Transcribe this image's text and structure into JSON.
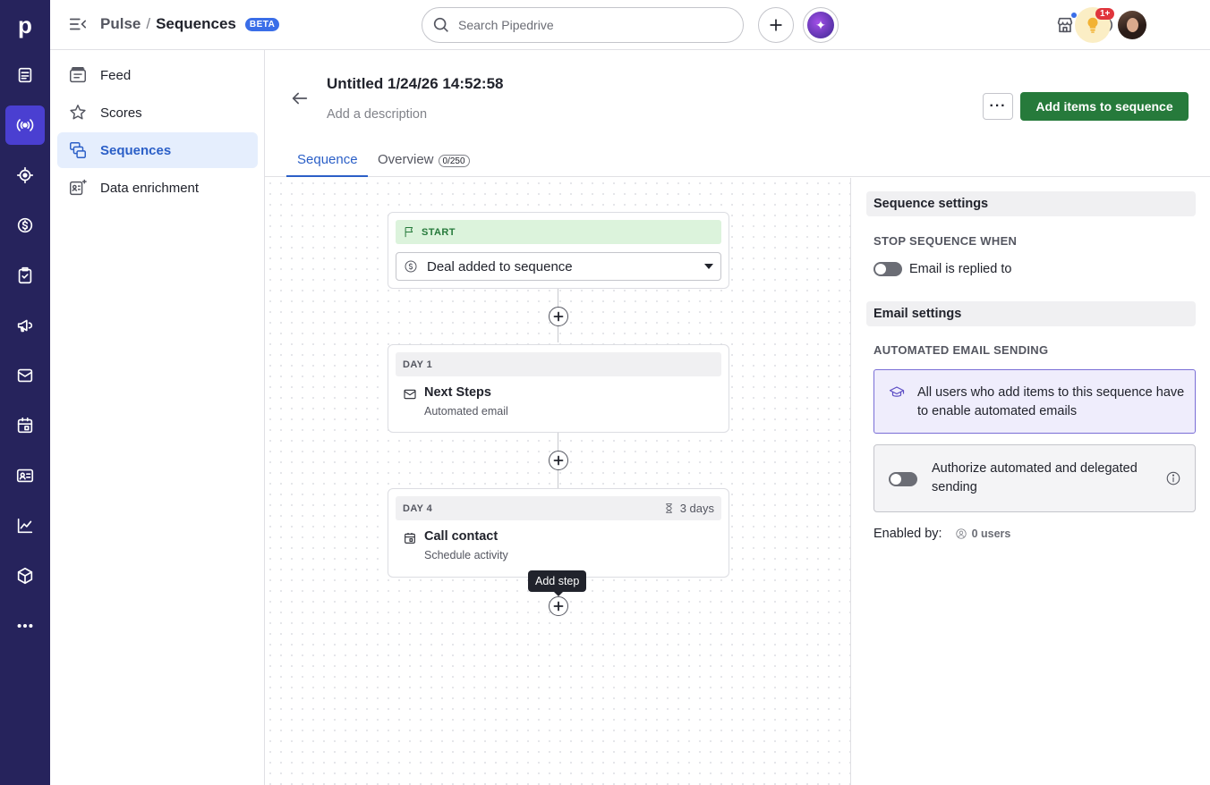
{
  "app": {
    "logo_letter": "p"
  },
  "rail": {
    "items": [
      {
        "name": "leads-icon"
      },
      {
        "name": "pulse-icon"
      },
      {
        "name": "focus-icon"
      },
      {
        "name": "deals-icon"
      },
      {
        "name": "tasks-icon"
      },
      {
        "name": "campaigns-icon"
      },
      {
        "name": "mail-icon"
      },
      {
        "name": "calendar-icon"
      },
      {
        "name": "contacts-icon"
      },
      {
        "name": "insights-icon"
      },
      {
        "name": "products-icon"
      },
      {
        "name": "more-icon"
      }
    ],
    "active": "pulse-icon"
  },
  "header": {
    "breadcrumb_parent": "Pulse",
    "breadcrumb_sep": "/",
    "breadcrumb_current": "Sequences",
    "beta": "BETA",
    "search_placeholder": "Search Pipedrive",
    "badge": "1+"
  },
  "sidebar": {
    "items": [
      {
        "label": "Feed",
        "icon": "feed-icon"
      },
      {
        "label": "Scores",
        "icon": "scores-icon"
      },
      {
        "label": "Sequences",
        "icon": "sequences-icon",
        "active": true
      },
      {
        "label": "Data enrichment",
        "icon": "data-enrichment-icon"
      }
    ]
  },
  "sequence": {
    "title": "Untitled 1/24/26 14:52:58",
    "description_placeholder": "Add a description",
    "more_label": "···",
    "primary_action": "Add items to sequence",
    "tabs": [
      {
        "label": "Sequence",
        "active": true
      },
      {
        "label": "Overview",
        "count": "0/250"
      }
    ]
  },
  "flow": {
    "start": {
      "label": "START",
      "trigger": "Deal added to sequence"
    },
    "steps": [
      {
        "day": "DAY 1",
        "title": "Next Steps",
        "subtitle": "Automated email",
        "icon": "mail-icon"
      },
      {
        "day": "DAY 4",
        "wait": "3 days",
        "title": "Call contact",
        "subtitle": "Schedule activity",
        "icon": "calendar-icon"
      }
    ],
    "tooltip": "Add step"
  },
  "settings": {
    "sequence_settings_title": "Sequence settings",
    "stop_when_label": "STOP SEQUENCE WHEN",
    "stop_when_toggle": "Email is replied to",
    "email_settings_title": "Email settings",
    "automated_sending_label": "AUTOMATED EMAIL SENDING",
    "info_text": "All users who add items to this sequence have to enable automated emails",
    "authorize_text": "Authorize automated and delegated sending",
    "enabled_by_label": "Enabled by:",
    "enabled_users": "0 users"
  },
  "colors": {
    "rail_bg": "#26235c",
    "accent": "#2b5fc7",
    "primary_button": "#267a3b",
    "start_header": "#dcf3dc",
    "active_rail": "#4a3fd1"
  }
}
